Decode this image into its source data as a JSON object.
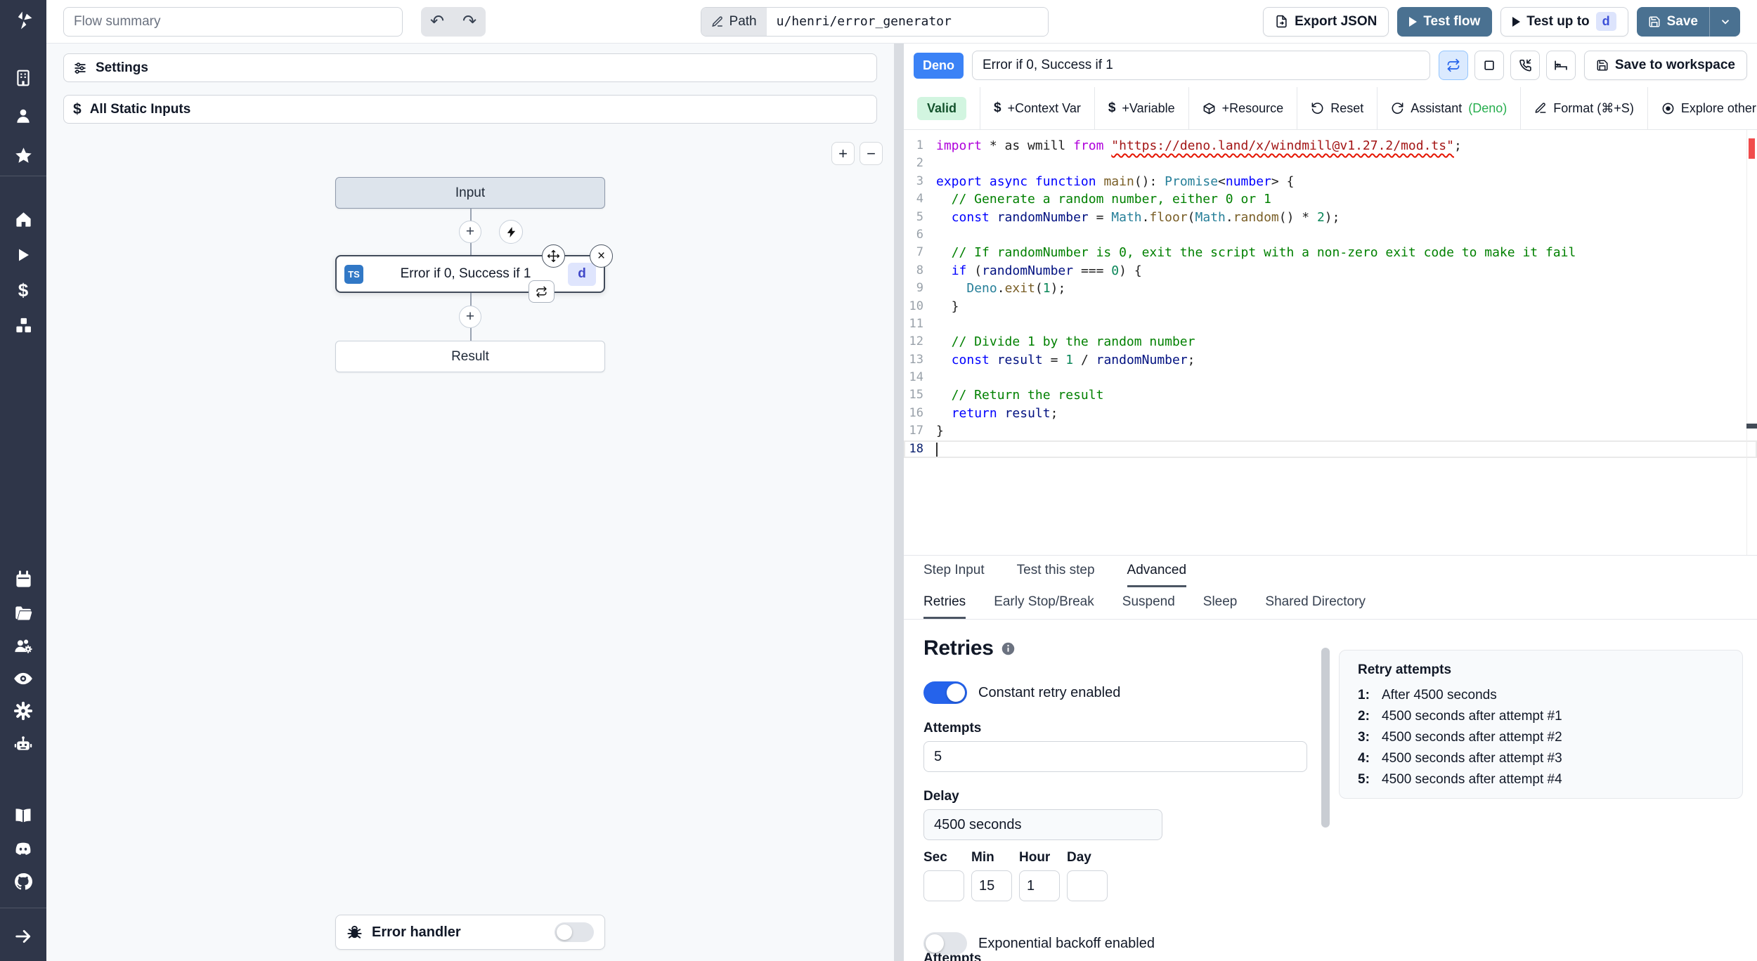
{
  "header": {
    "flow_summary_placeholder": "Flow summary",
    "undo": "↶",
    "redo": "↷",
    "path_label": "Path",
    "path_value": "u/henri/error_generator",
    "export_json": "Export JSON",
    "test_flow": "Test flow",
    "test_up_to": "Test up to",
    "test_up_to_badge": "d",
    "save": "Save"
  },
  "rail": {
    "icons": [
      "windmill-logo",
      "building",
      "user",
      "star",
      "home",
      "play",
      "dollar",
      "boxes",
      "calendar",
      "folder",
      "user-group",
      "eye",
      "gear",
      "robot",
      "book",
      "discord",
      "github",
      "arrow-right"
    ]
  },
  "flow_panel": {
    "settings": "Settings",
    "all_static_inputs": "All Static Inputs",
    "zoom_in": "+",
    "zoom_out": "−",
    "graph": {
      "input_node": "Input",
      "module_lang_badge": "TS",
      "module_label": "Error if 0, Success if 1",
      "module_id_badge": "d",
      "plus": "+",
      "close": "×",
      "result_node": "Result",
      "error_handler": "Error handler"
    }
  },
  "step_header": {
    "lang_badge": "Deno",
    "title_value": "Error if 0, Success if 1",
    "save_to_workspace": "Save to workspace"
  },
  "toolbar": {
    "valid": "Valid",
    "dollar": "$",
    "context_var": "+Context Var",
    "variable": "+Variable",
    "resource": "+Resource",
    "reset": "Reset",
    "assistant": "Assistant",
    "assistant_lang": "(Deno)",
    "format": "Format (⌘+S)",
    "explore": "Explore other s"
  },
  "editor": {
    "lines": [
      {
        "tokens": [
          [
            "import",
            "kp"
          ],
          [
            " * as wmill ",
            "pl"
          ],
          [
            "from",
            "kp"
          ],
          [
            " ",
            "pl"
          ],
          [
            "\"https://deno.land/x/windmill@v1.27.2/mod.ts\"",
            "str"
          ],
          [
            ";",
            "pl"
          ]
        ]
      },
      {
        "tokens": []
      },
      {
        "tokens": [
          [
            "export",
            "kb"
          ],
          [
            " ",
            "pl"
          ],
          [
            "async",
            "kb"
          ],
          [
            " ",
            "pl"
          ],
          [
            "function",
            "kb"
          ],
          [
            " ",
            "pl"
          ],
          [
            "main",
            "fn"
          ],
          [
            "(): ",
            "pl"
          ],
          [
            "Promise",
            "ty"
          ],
          [
            "<",
            "pl"
          ],
          [
            "number",
            "kb"
          ],
          [
            "> {",
            "pl"
          ]
        ]
      },
      {
        "tokens": [
          [
            "  // Generate a random number, either 0 or 1",
            "cm"
          ]
        ]
      },
      {
        "tokens": [
          [
            "  ",
            "pl"
          ],
          [
            "const",
            "kb"
          ],
          [
            " ",
            "pl"
          ],
          [
            "randomNumber",
            "id"
          ],
          [
            " = ",
            "pl"
          ],
          [
            "Math",
            "ty"
          ],
          [
            ".",
            "pl"
          ],
          [
            "floor",
            "fn"
          ],
          [
            "(",
            "pl"
          ],
          [
            "Math",
            "ty"
          ],
          [
            ".",
            "pl"
          ],
          [
            "random",
            "fn"
          ],
          [
            "() * ",
            "pl"
          ],
          [
            "2",
            "num"
          ],
          [
            ");",
            "pl"
          ]
        ]
      },
      {
        "tokens": []
      },
      {
        "tokens": [
          [
            "  // If randomNumber is 0, exit the script with a non-zero exit code to make it fail",
            "cm"
          ]
        ]
      },
      {
        "tokens": [
          [
            "  ",
            "pl"
          ],
          [
            "if",
            "kb"
          ],
          [
            " (",
            "pl"
          ],
          [
            "randomNumber",
            "id"
          ],
          [
            " === ",
            "pl"
          ],
          [
            "0",
            "num"
          ],
          [
            ") {",
            "pl"
          ]
        ]
      },
      {
        "tokens": [
          [
            "    ",
            "pl"
          ],
          [
            "Deno",
            "ty"
          ],
          [
            ".",
            "pl"
          ],
          [
            "exit",
            "fn"
          ],
          [
            "(",
            "pl"
          ],
          [
            "1",
            "num"
          ],
          [
            ");",
            "pl"
          ]
        ]
      },
      {
        "tokens": [
          [
            "  }",
            "pl"
          ]
        ]
      },
      {
        "tokens": []
      },
      {
        "tokens": [
          [
            "  // Divide 1 by the random number",
            "cm"
          ]
        ]
      },
      {
        "tokens": [
          [
            "  ",
            "pl"
          ],
          [
            "const",
            "kb"
          ],
          [
            " ",
            "pl"
          ],
          [
            "result",
            "id"
          ],
          [
            " = ",
            "pl"
          ],
          [
            "1",
            "num"
          ],
          [
            " / ",
            "pl"
          ],
          [
            "randomNumber",
            "id"
          ],
          [
            ";",
            "pl"
          ]
        ]
      },
      {
        "tokens": []
      },
      {
        "tokens": [
          [
            "  // Return the result",
            "cm"
          ]
        ]
      },
      {
        "tokens": [
          [
            "  ",
            "pl"
          ],
          [
            "return",
            "kb"
          ],
          [
            " ",
            "pl"
          ],
          [
            "result",
            "id"
          ],
          [
            ";",
            "pl"
          ]
        ]
      },
      {
        "tokens": [
          [
            "}",
            "pl"
          ]
        ]
      },
      {
        "tokens": [],
        "current": true
      }
    ]
  },
  "tabs": {
    "row1": [
      {
        "label": "Step Input"
      },
      {
        "label": "Test this step"
      },
      {
        "label": "Advanced"
      }
    ],
    "row2": [
      {
        "label": "Retries"
      },
      {
        "label": "Early Stop/Break"
      },
      {
        "label": "Suspend"
      },
      {
        "label": "Sleep"
      },
      {
        "label": "Shared Directory"
      }
    ]
  },
  "retries": {
    "title": "Retries",
    "constant_toggle_label": "Constant retry enabled",
    "attempts_label": "Attempts",
    "attempts_value": "5",
    "delay_label": "Delay",
    "delay_value": "4500 seconds",
    "sec_label": "Sec",
    "min_label": "Min",
    "hour_label": "Hour",
    "day_label": "Day",
    "sec_value": "",
    "min_value": "15",
    "hour_value": "1",
    "day_value": "",
    "exponential_toggle_label": "Exponential backoff enabled",
    "clipped_label": "Attempts",
    "summary": {
      "title": "Retry attempts",
      "items": [
        {
          "n": "1:",
          "text": "After 4500 seconds"
        },
        {
          "n": "2:",
          "text": "4500 seconds after attempt #1"
        },
        {
          "n": "3:",
          "text": "4500 seconds after attempt #2"
        },
        {
          "n": "4:",
          "text": "4500 seconds after attempt #3"
        },
        {
          "n": "5:",
          "text": "4500 seconds after attempt #4"
        }
      ]
    }
  },
  "colors": {
    "rail_bg": "#2f3649",
    "primary_button": "#4a7191",
    "deno_badge": "#3b82f6",
    "toggle_on": "#2563eb",
    "valid_bg": "#d2f5e0",
    "assistant_green": "#27ae4e",
    "ts_badge": "#3178c6",
    "error_squiggle": "#e51400"
  }
}
